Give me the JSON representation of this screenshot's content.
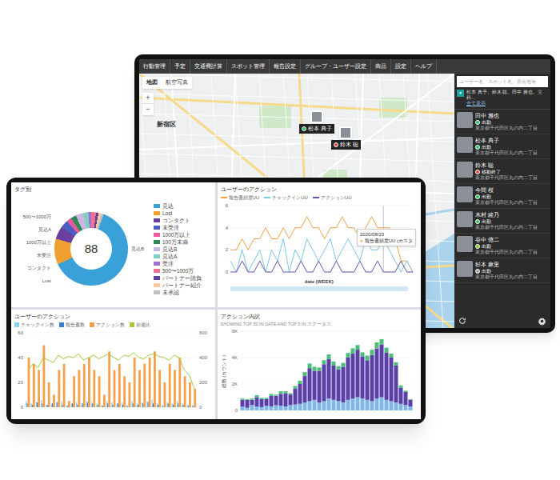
{
  "map_app": {
    "menu": [
      "行動管理",
      "予定",
      "交通費計算",
      "スポット管理",
      "報告設定",
      "グループ・ユーザー設定",
      "商品",
      "設定",
      "ヘルプ"
    ],
    "map_tabs": [
      {
        "label": "地図",
        "selected": true
      },
      {
        "label": "航空写真",
        "selected": false
      }
    ],
    "zoom": {
      "in": "+",
      "out": "−"
    },
    "area_label": "新宿区",
    "markers": [
      {
        "name": "松本 典子",
        "color": "#22c55e"
      },
      {
        "name": "鈴木 聡",
        "color": "#ef4444"
      }
    ],
    "search": {
      "placeholder": "ユーザー名、スポット名、所在地等"
    },
    "filter": {
      "icon": "▼",
      "text": "松本 典子、鈴木 聡、田中 雅也、立科...",
      "link": "全て表示"
    },
    "users": [
      {
        "name": "田中 雅也",
        "status": "出勤",
        "address": "東京都千代田区丸の内二丁目",
        "color": "#22c55e"
      },
      {
        "name": "松本 典子",
        "status": "出勤",
        "address": "東京都千代田区丸の内二丁目",
        "color": "#22c55e"
      },
      {
        "name": "鈴木 聡",
        "status": "移動終了",
        "address": "東京都千代田区丸の内二丁目",
        "color": "#ef4444"
      },
      {
        "name": "今間 桜",
        "status": "出勤",
        "address": "東京都千代田区丸の内二丁目",
        "color": "#22c55e"
      },
      {
        "name": "木村 綾乃",
        "status": "出勤",
        "address": "東京都千代田区丸の内二丁目",
        "color": "#22c55e"
      },
      {
        "name": "谷中 信二",
        "status": "出勤",
        "address": "東京都千代田区丸の内二丁目",
        "color": "#84cc16"
      },
      {
        "name": "杉本 麻里",
        "status": "出勤",
        "address": "東京都千代田区丸の内二丁目",
        "color": "#9ca3af"
      }
    ]
  },
  "dashboard": {
    "tags": {
      "title": "タグ別",
      "total": "88",
      "callouts_left": [
        "500〜1000万",
        "見込A",
        "1000万以上",
        "未受注",
        "コンタクト",
        "Lost"
      ],
      "callouts_right": [
        "見込B"
      ],
      "segments": [
        {
          "label": "見込",
          "value": 55,
          "color": "#3aa0d8"
        },
        {
          "label": "Lost",
          "value": 10,
          "color": "#f0a030"
        },
        {
          "label": "コンタクト",
          "value": 5,
          "color": "#6a3fa0"
        },
        {
          "label": "未受注",
          "value": 3,
          "color": "#4a5fc0"
        },
        {
          "label": "1000万以上",
          "value": 2,
          "color": "#e85a9b"
        },
        {
          "label": "100万未満",
          "value": 2,
          "color": "#2e8b57"
        },
        {
          "label": "見込B",
          "value": 3,
          "color": "#c8b8e0"
        },
        {
          "label": "見込A",
          "value": 2,
          "color": "#7fd0c0"
        },
        {
          "label": "受注",
          "value": 1,
          "color": "#a070d0"
        },
        {
          "label": "500〜1000万",
          "value": 2,
          "color": "#f07090"
        },
        {
          "label": "パートナー請負",
          "value": 1,
          "color": "#6040a0"
        },
        {
          "label": "パートナー紹介",
          "value": 1,
          "color": "#f8c8a0"
        },
        {
          "label": "未承認",
          "value": 1,
          "color": "#c0c0c0"
        }
      ]
    },
    "actions_line": {
      "title": "ユーザーのアクション",
      "y_ticks": [
        "0",
        "2",
        "4",
        "6"
      ],
      "x_label": "date (WEEK)",
      "series": [
        {
          "label": "報告書頻度UU",
          "color": "#f5a04a",
          "values": [
            2,
            2,
            3,
            2,
            3,
            3,
            4,
            3,
            3,
            4,
            3,
            4,
            4,
            5,
            4,
            4,
            3,
            4,
            4,
            5,
            4,
            4,
            3,
            4,
            5,
            4,
            4,
            4,
            3,
            1,
            1,
            0
          ]
        },
        {
          "label": "チェックインUU",
          "color": "#7cc6e8",
          "values": [
            1,
            0,
            2,
            0,
            1,
            2,
            0,
            2,
            1,
            3,
            0,
            2,
            1,
            3,
            2,
            1,
            2,
            3,
            1,
            2,
            3,
            2,
            1,
            3,
            2,
            2,
            3,
            2,
            1,
            0,
            1,
            0
          ]
        },
        {
          "label": "アクションUU",
          "color": "#6a4fb0",
          "values": [
            0,
            0,
            1,
            0,
            0,
            1,
            0,
            0,
            1,
            0,
            0,
            0,
            1,
            0,
            0,
            1,
            0,
            0,
            1,
            0,
            0,
            0,
            1,
            0,
            0,
            1,
            0,
            0,
            0,
            1,
            0,
            0
          ]
        }
      ],
      "tooltip": {
        "date": "2020/08/23",
        "dot": "●",
        "series": "報告書頻度UU (カスタ"
      }
    },
    "actions_bar": {
      "title": "ユーザーのアクション",
      "left_ticks": [
        "0",
        "20",
        "40",
        "60"
      ],
      "right_ticks": [
        "0",
        "200",
        "400",
        "600"
      ],
      "series": [
        {
          "label": "チェックイン数",
          "color": "#8fd0ee",
          "kind": "bar",
          "values": [
            5,
            3,
            4,
            6,
            2,
            3,
            4,
            5,
            2,
            3,
            4,
            3,
            5,
            4,
            3,
            2,
            5,
            4,
            3,
            4,
            2,
            5,
            3,
            4,
            5,
            6,
            3,
            2,
            4,
            3,
            5,
            3,
            2,
            2
          ]
        },
        {
          "label": "報告書数",
          "color": "#3a7fd0",
          "kind": "bar",
          "values": [
            3,
            2,
            4,
            3,
            2,
            3,
            4,
            2,
            1,
            3,
            2,
            3,
            4,
            3,
            2,
            1,
            3,
            2,
            3,
            2,
            1,
            3,
            2,
            3,
            4,
            3,
            2,
            1,
            3,
            2,
            3,
            2,
            1,
            1
          ]
        },
        {
          "label": "アクション数",
          "color": "#f5a04a",
          "kind": "bar",
          "values": [
            40,
            35,
            30,
            50,
            20,
            10,
            30,
            35,
            5,
            25,
            30,
            35,
            40,
            30,
            25,
            10,
            45,
            30,
            35,
            25,
            20,
            40,
            30,
            35,
            40,
            45,
            30,
            20,
            35,
            30,
            40,
            25,
            20,
            15
          ]
        },
        {
          "label": "前週比",
          "color": "#a8c83c",
          "kind": "line",
          "values": [
            300,
            350,
            320,
            400,
            380,
            360,
            420,
            390,
            410,
            400,
            430,
            380,
            400,
            420,
            390,
            410,
            430,
            400,
            380,
            420,
            410,
            440,
            400,
            390,
            420,
            430,
            410,
            400,
            380,
            420,
            400,
            300,
            260,
            150
          ]
        }
      ]
    },
    "breakdown": {
      "title": "アクション内訳",
      "subtitle": "SHOWING TOP 50 IN DATE AND TOP 5 IN ステータス",
      "y_label": "総数 (カウント)",
      "y_ticks": [
        "0",
        "2K",
        "4K",
        "6K"
      ],
      "series": [
        {
          "color": "#7fb8e8",
          "values": [
            300,
            200,
            400,
            300,
            250,
            350,
            300,
            400,
            350,
            300,
            400,
            450,
            500,
            600,
            700,
            800,
            600,
            700,
            900,
            800,
            700,
            600,
            800,
            900,
            1000,
            900,
            800,
            700,
            900,
            1000,
            800,
            700,
            600,
            500,
            400,
            300
          ]
        },
        {
          "color": "#5a3fa8",
          "values": [
            500,
            600,
            400,
            700,
            600,
            500,
            800,
            700,
            900,
            1000,
            800,
            1200,
            1500,
            2000,
            2500,
            2200,
            2400,
            2800,
            3000,
            2600,
            2400,
            2700,
            3200,
            3400,
            3600,
            3200,
            3000,
            3500,
            3800,
            4000,
            3600,
            3300,
            2800,
            1200,
            1000,
            500
          ]
        },
        {
          "color": "#4cbf7a",
          "values": [
            100,
            50,
            100,
            150,
            100,
            100,
            150,
            100,
            200,
            150,
            100,
            200,
            250,
            300,
            350,
            300,
            250,
            300,
            350,
            300,
            250,
            300,
            350,
            400,
            350,
            300,
            350,
            400,
            450,
            400,
            350,
            300,
            250,
            200,
            100,
            50
          ]
        }
      ]
    }
  }
}
